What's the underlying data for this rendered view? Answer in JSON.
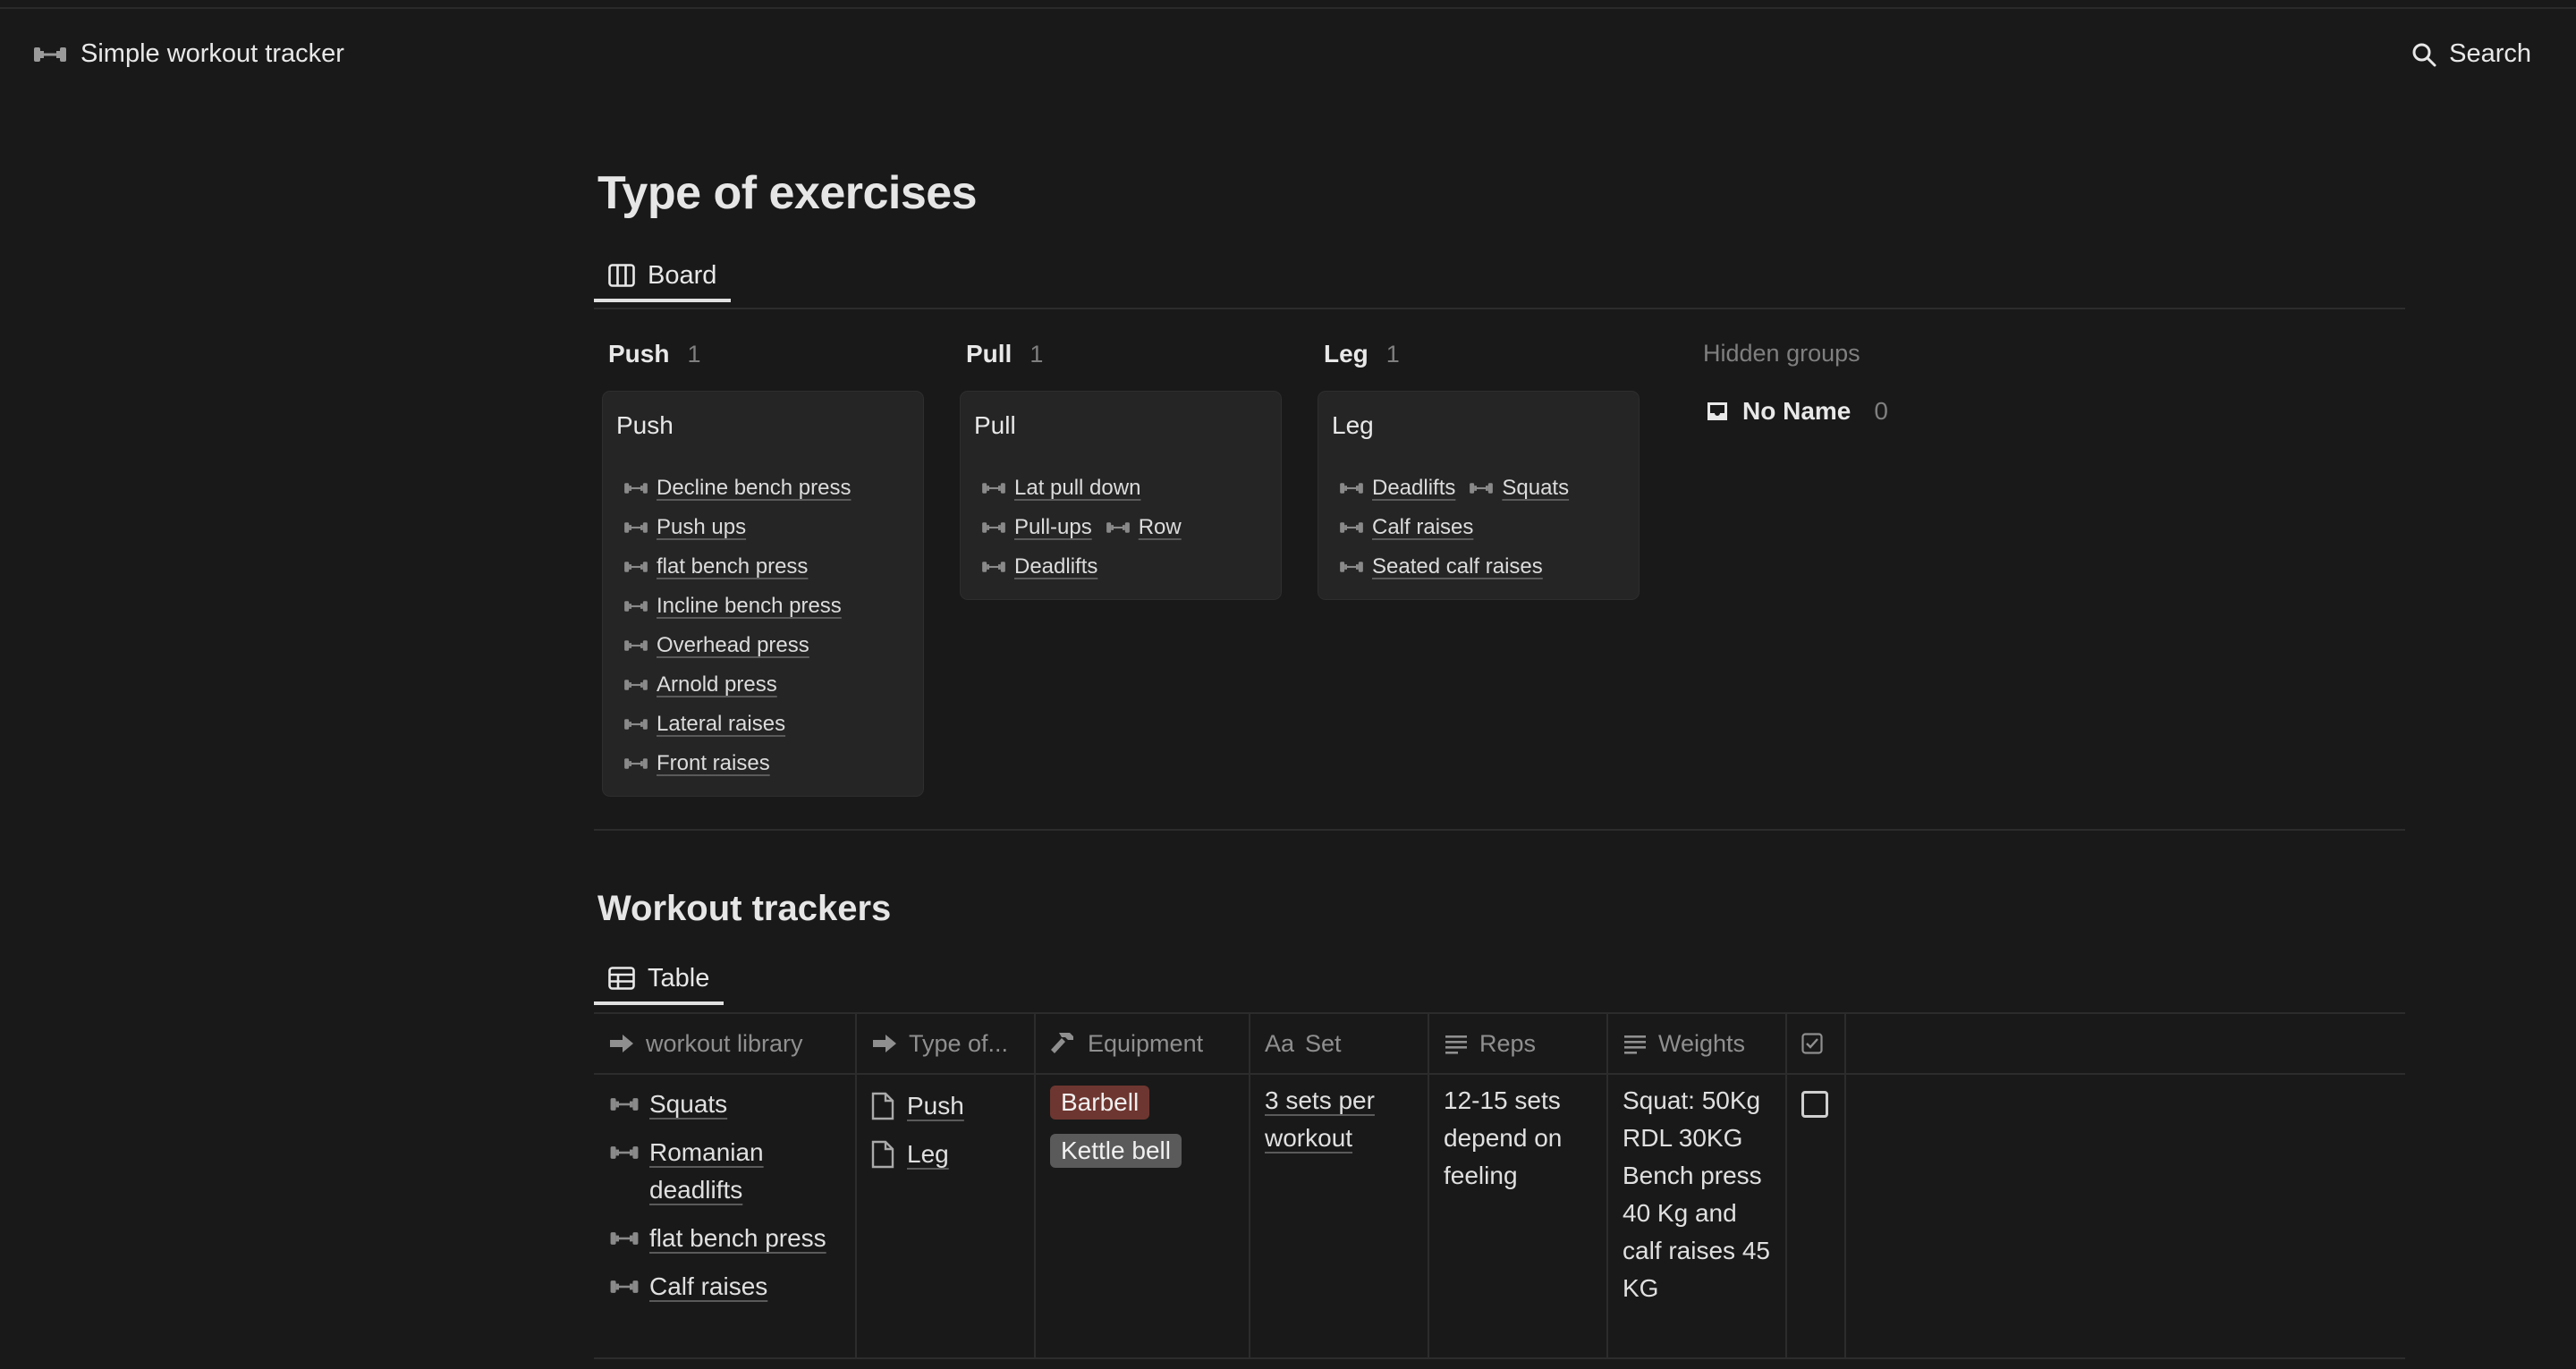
{
  "topbar": {
    "app_title": "Simple workout tracker",
    "app_icon": "dumbbell-icon",
    "search_label": "Search"
  },
  "board_section": {
    "title": "Type of exercises",
    "view_tab": "Board",
    "columns": [
      {
        "name": "Push",
        "count": "1",
        "card_title": "Push",
        "items": [
          [
            "Decline bench press"
          ],
          [
            "Push ups"
          ],
          [
            " flat bench press"
          ],
          [
            "Incline bench press"
          ],
          [
            "Overhead press"
          ],
          [
            "Arnold press"
          ],
          [
            "Lateral raises"
          ],
          [
            "Front raises"
          ]
        ]
      },
      {
        "name": "Pull",
        "count": "1",
        "card_title": "Pull",
        "items": [
          [
            "Lat pull down"
          ],
          [
            "Pull-ups",
            "Row"
          ],
          [
            "Deadlifts"
          ]
        ]
      },
      {
        "name": "Leg",
        "count": "1",
        "card_title": "Leg",
        "items": [
          [
            "Deadlifts",
            "Squats"
          ],
          [
            "Calf raises"
          ],
          [
            "Seated calf raises"
          ]
        ]
      }
    ],
    "hidden_groups_label": "Hidden groups",
    "no_name_label": "No Name",
    "no_name_count": "0"
  },
  "table_section": {
    "title": "Workout trackers",
    "view_tab": "Table",
    "headers": {
      "workout_library": "workout library",
      "type_of": "Type of...",
      "equipment": "Equipment",
      "set": "Set",
      "set_prefix": "Aa",
      "reps": "Reps",
      "weights": "Weights"
    },
    "row": {
      "workouts": [
        "Squats",
        "Romanian deadlifts",
        " flat bench press",
        "Calf raises"
      ],
      "types": [
        "Push",
        "Leg"
      ],
      "equipment": [
        {
          "label": "Barbell",
          "color": "#6e3630"
        },
        {
          "label": "Kettle bell",
          "color": "#5a5a5a"
        }
      ],
      "set": "3 sets per workout",
      "reps": "12-15 sets depend on feeling",
      "weights": "Squat: 50Kg RDL 30KG Bench press 40 Kg and calf raises 45 KG",
      "checked": false
    }
  }
}
